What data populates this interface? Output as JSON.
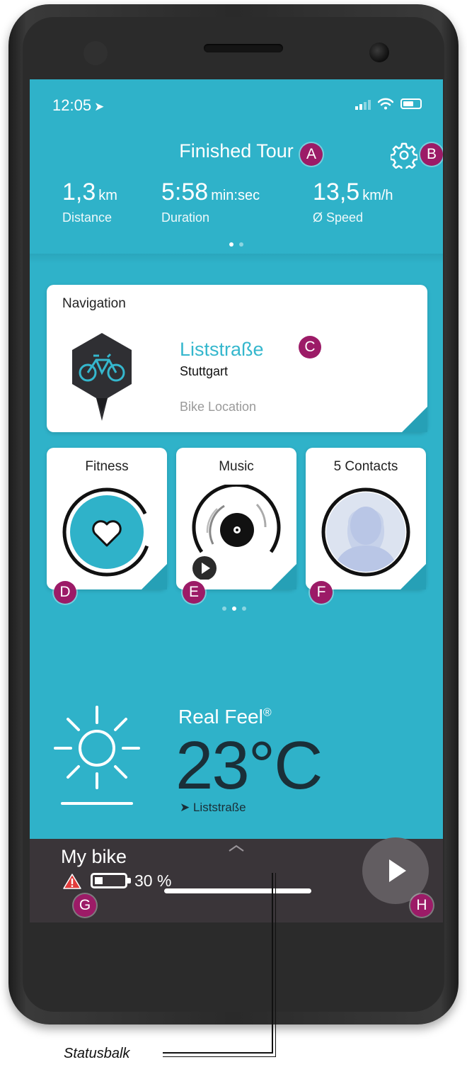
{
  "status_bar": {
    "time": "12:05"
  },
  "header": {
    "title": "Finished Tour",
    "stats": [
      {
        "value": "1,3",
        "unit": "km",
        "label": "Distance"
      },
      {
        "value": "5:58",
        "unit": "min:sec",
        "label": "Duration"
      },
      {
        "value": "13,5",
        "unit": "km/h",
        "label": "Ø Speed"
      }
    ]
  },
  "navigation_card": {
    "title": "Navigation",
    "street": "Liststraße",
    "city": "Stuttgart",
    "caption": "Bike Location"
  },
  "tiles": {
    "fitness": "Fitness",
    "music": "Music",
    "contacts": "5 Contacts"
  },
  "weather": {
    "label": "Real Feel",
    "registered": "®",
    "temperature": "23°C",
    "location": "Liststraße"
  },
  "bike": {
    "name": "My bike",
    "battery": "30 %",
    "battery_level": 0.3
  },
  "markers": {
    "a": "A",
    "b": "B",
    "c": "C",
    "d": "D",
    "e": "E",
    "f": "F",
    "g": "G",
    "h": "H"
  },
  "caption": "Statusbalk",
  "colors": {
    "screen": "#2fb2c9",
    "accent_text": "#35b7cd",
    "marker": "#9c1b67",
    "bottom_bar": "#3a3539"
  }
}
